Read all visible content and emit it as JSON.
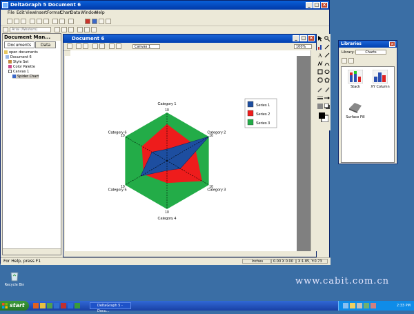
{
  "app": {
    "title": "DeltaGraph 5 Document 6",
    "menu": [
      "File",
      "Edit",
      "View",
      "Insert",
      "Format",
      "Chart",
      "Data",
      "Window",
      "Help"
    ],
    "font_field": "Arial (Western)",
    "status": "For Help, press F1",
    "units": "Inches",
    "size_readout": "0.00 X 0.00",
    "pos_readout": "X:1.85, Y:0.73"
  },
  "doc_manager": {
    "title": "Document Man...",
    "tabs": [
      "Documents",
      "Data"
    ],
    "tree": [
      "open documents",
      "Document 6",
      "Style Set",
      "Color Palette",
      "Canvas 1",
      "Spider Chart"
    ]
  },
  "document": {
    "title": "Document 6",
    "canvas_select": "Canvas 1",
    "zoom": "100%"
  },
  "libraries": {
    "title": "Libraries",
    "library_label": "Library:",
    "library_value": "Charts",
    "items": [
      "Stack",
      "XY Column",
      "Surface Fill"
    ]
  },
  "desktop": {
    "recycle_bin": "Recycle Bin",
    "watermark": "www.cabit.com.cn"
  },
  "taskbar": {
    "start": "start",
    "task_button": "DeltaGraph 5 - Docu...",
    "clock": "2:33 PM"
  },
  "colors": {
    "series1": "#1d4ea0",
    "series2": "#ee1c1c",
    "series3": "#23ac48"
  },
  "chart_data": {
    "type": "radar",
    "categories": [
      "Category 1",
      "Category 2",
      "Category 3",
      "Category 4",
      "Category 5",
      "Category 6"
    ],
    "series": [
      {
        "name": "Series 1",
        "values": [
          2.4,
          10,
          3.2,
          2.0,
          6.3,
          3.6
        ]
      },
      {
        "name": "Series 2",
        "values": [
          7.6,
          6.6,
          8.4,
          4.6,
          5.6,
          6.0
        ]
      },
      {
        "name": "Series 3",
        "values": [
          10,
          10,
          10,
          10,
          10,
          10
        ]
      }
    ],
    "axis_max_labels": [
      "10",
      "10",
      "10",
      "10",
      "10",
      "10"
    ],
    "rmax": 10,
    "legend_position": "right"
  }
}
